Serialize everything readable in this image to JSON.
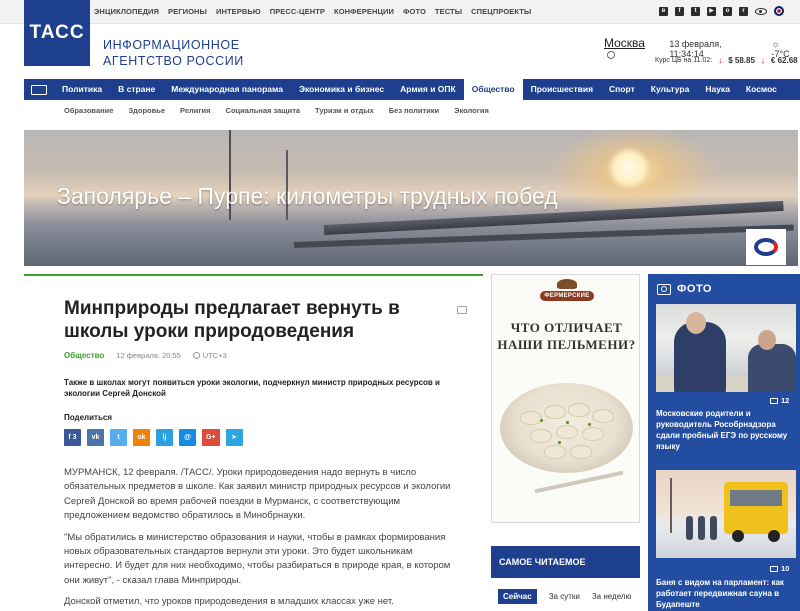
{
  "top_nav": [
    "ЭНЦИКЛОПЕДИЯ",
    "РЕГИОНЫ",
    "ИНТЕРВЬЮ",
    "ПРЕСС-ЦЕНТР",
    "КОНФЕРЕНЦИИ",
    "ФОТО",
    "ТЕСТЫ",
    "СПЕЦПРОЕКТЫ"
  ],
  "social_icons": [
    "vk-icon",
    "facebook-icon",
    "twitter-icon",
    "youtube-icon",
    "odnoklassniki-icon",
    "rss-icon",
    "eye-icon",
    "language-flag-icon"
  ],
  "header": {
    "logo": "ТАСС",
    "agency_line1": "ИНФОРМАЦИОННОЕ",
    "agency_line2": "АГЕНТСТВО РОССИИ",
    "city": "Москва",
    "datetime": "13 февраля, 11:34:14",
    "temperature": "-7°C",
    "rates_label": "Курс ЦБ на 11.02:",
    "usd": "$ 58.85",
    "eur": "€ 62.68"
  },
  "main_nav": [
    "Политика",
    "В стране",
    "Международная панорама",
    "Экономика и бизнес",
    "Армия и ОПК",
    "Общество",
    "Происшествия",
    "Спорт",
    "Культура",
    "Наука",
    "Космос"
  ],
  "main_nav_active": "Общество",
  "sub_nav": [
    "Образование",
    "Здоровье",
    "Религия",
    "Социальная защита",
    "Туризм и отдых",
    "Без политики",
    "Экология"
  ],
  "hero": {
    "title": "Заполярье – Пурпе: километры трудных побед"
  },
  "article": {
    "title": "Минприроды предлагает вернуть в школы уроки природоведения",
    "category": "Общество",
    "date": "12 февраля, 20:55",
    "timezone": "UTC+3",
    "lead": "Также в школах могут появиться уроки экологии, подчеркнул министр природных ресурсов и экологии Сергей Донской",
    "share_label": "Поделиться",
    "share_buttons": [
      {
        "name": "share-facebook",
        "label": "f  3",
        "color": "#3b5998"
      },
      {
        "name": "share-vk",
        "label": "vk",
        "color": "#4c75a3"
      },
      {
        "name": "share-twitter",
        "label": "t",
        "color": "#55acee"
      },
      {
        "name": "share-odnoklassniki",
        "label": "ok",
        "color": "#ee8208"
      },
      {
        "name": "share-livejournal",
        "label": "lj",
        "color": "#2c9fe0"
      },
      {
        "name": "share-email",
        "label": "@",
        "color": "#168de2"
      },
      {
        "name": "share-googleplus",
        "label": "G+",
        "color": "#dd4b39"
      },
      {
        "name": "share-telegram",
        "label": "➤",
        "color": "#2ca5e0"
      }
    ],
    "paragraphs": [
      "МУРМАНСК, 12 февраля. /ТАСС/. Уроки природоведения надо вернуть в число обязательных предметов в школе. Как заявил министр природных ресурсов и экологии Сергей Донской во время рабочей поездки в Мурманск, с соответствующим предложением ведомство обратилось в Минобрнауки.",
      "\"Мы обратились в министерство образования и науки, чтобы в рамках формирования новых образовательных стандартов вернули эти уроки. Это будет школьникам интересно. И будет для них необходимо, чтобы разбираться в природе края, в котором они живут\", - сказал глава Минприроды.",
      "Донской отметил, что уроков природоведения в младших классах уже нет."
    ]
  },
  "ad": {
    "brand": "ФЕРМЕРСКИЕ",
    "headline_line1": "ЧТО ОТЛИЧАЕТ",
    "headline_line2": "НАШИ ПЕЛЬМЕНИ?"
  },
  "most_read": {
    "title": "САМОЕ ЧИТАЕМОЕ",
    "tabs": [
      "Сейчас",
      "За сутки",
      "За неделю"
    ],
    "active_tab": "Сейчас"
  },
  "photo": {
    "title": "ФОТО",
    "items": [
      {
        "count": "12",
        "caption": "Московские родители и руководитель Рособрнадзора сдали пробный ЕГЭ по русскому языку"
      },
      {
        "count": "10",
        "caption": "Баня с видом на парламент: как работает передвижная сауна в Будапеште"
      }
    ]
  },
  "colors": {
    "brand_blue": "#1d3f8e",
    "accent_green": "#3ea12b",
    "photo_panel": "#234da0"
  }
}
